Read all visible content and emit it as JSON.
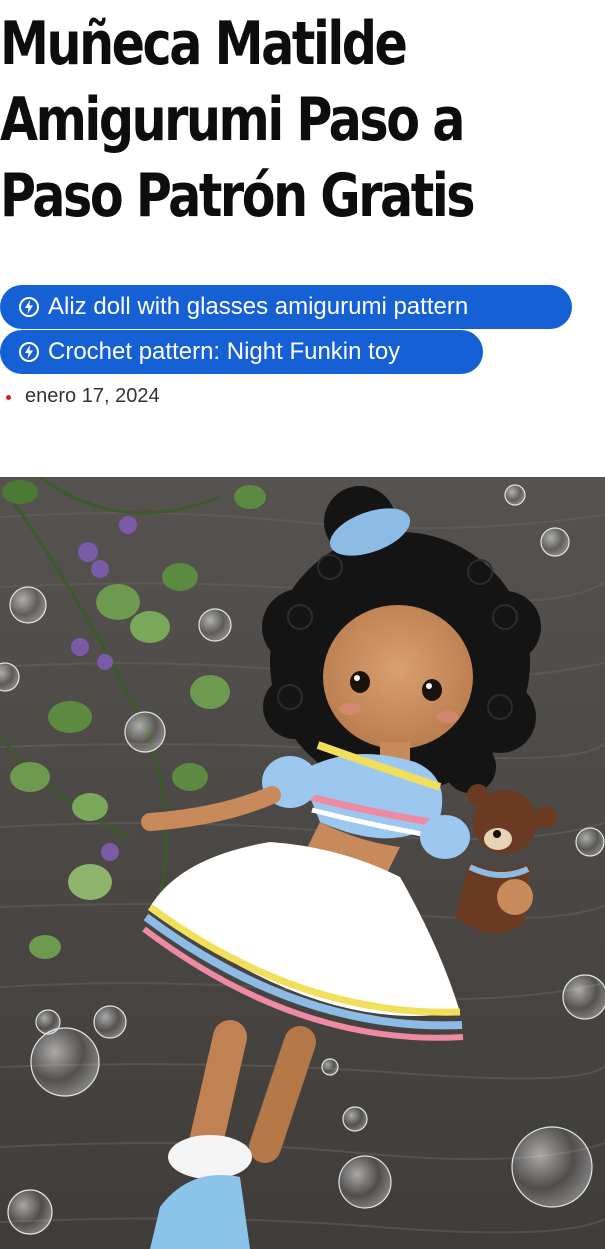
{
  "article": {
    "title": "Muñeca Matilde Amigurumi Paso a Paso Patrón Gratis",
    "related_links": [
      {
        "label": "Aliz doll with glasses amigurumi pattern",
        "icon": "bolt-circle-icon"
      },
      {
        "label": "Crochet pattern: Night Funkin toy",
        "icon": "bolt-circle-icon"
      }
    ],
    "date": "enero 17, 2024"
  },
  "colors": {
    "pill_bg": "#1560d4",
    "pill_text": "#ffffff",
    "date_dot": "#d42020",
    "wood": "#4a4744"
  },
  "image": {
    "icon": "photo-crochet-doll"
  }
}
